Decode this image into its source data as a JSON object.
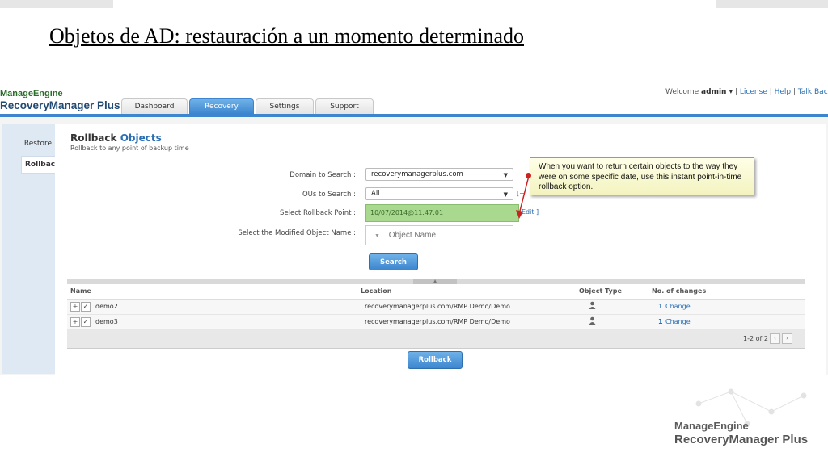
{
  "slide": {
    "title": "Objetos de AD: restauración a un momento determinado"
  },
  "app": {
    "logo_top": "ManageEngine",
    "logo_product": "RecoveryManager Plus",
    "welcome_prefix": "Welcome",
    "user": "admin ▾",
    "links": [
      "License",
      "Help",
      "Talk Back"
    ],
    "tabs": [
      {
        "label": "Dashboard",
        "active": false
      },
      {
        "label": "Recovery",
        "active": true
      },
      {
        "label": "Settings",
        "active": false
      },
      {
        "label": "Support",
        "active": false
      }
    ]
  },
  "sidebar": {
    "items": [
      {
        "label": "Restore",
        "active": false
      },
      {
        "label": "Rollback",
        "active": true
      }
    ]
  },
  "page": {
    "title_a": "Rollback",
    "title_b": "Objects",
    "subtitle": "Rollback to any point of backup time"
  },
  "form": {
    "domain_label": "Domain to Search :",
    "domain_value": "recoverymanagerplus.com",
    "ous_label": "OUs to Search :",
    "ous_value": "All",
    "ous_extra": "[+",
    "rollback_label": "Select Rollback Point :",
    "rollback_value": "10/07/2014@11:47:01",
    "edit_label": "Edit ]",
    "object_label": "Select the Modified Object Name :",
    "object_placeholder": "Object Name",
    "search_button": "Search"
  },
  "callout": {
    "text": "When you want to return certain objects to the way they were on some specific date, use this instant point-in-time rollback option."
  },
  "grid": {
    "headers": [
      "Name",
      "Location",
      "Object Type",
      "No. of changes"
    ],
    "rows": [
      {
        "expand": "+",
        "check": "✓",
        "name": "demo2",
        "location": "recoverymanagerplus.com/RMP Demo/Demo",
        "type_icon": "user-icon",
        "changes": "1",
        "change_link": "Change"
      },
      {
        "expand": "+",
        "check": "✓",
        "name": "demo3",
        "location": "recoverymanagerplus.com/RMP Demo/Demo",
        "type_icon": "user-icon",
        "changes": "1",
        "change_link": "Change"
      }
    ],
    "pager": "1-2 of 2",
    "prev_icon": "‹",
    "next_icon": "›",
    "collapse_icon": "▲"
  },
  "actions": {
    "rollback_button": "Rollback"
  },
  "brand": {
    "line1": "ManageEngine",
    "line2": "RecoveryManager Plus"
  },
  "colors": {
    "accent": "#3d86cf",
    "highlight": "#a8d98e",
    "callout_bg": "#ffffe0",
    "link": "#2a6fb5"
  }
}
